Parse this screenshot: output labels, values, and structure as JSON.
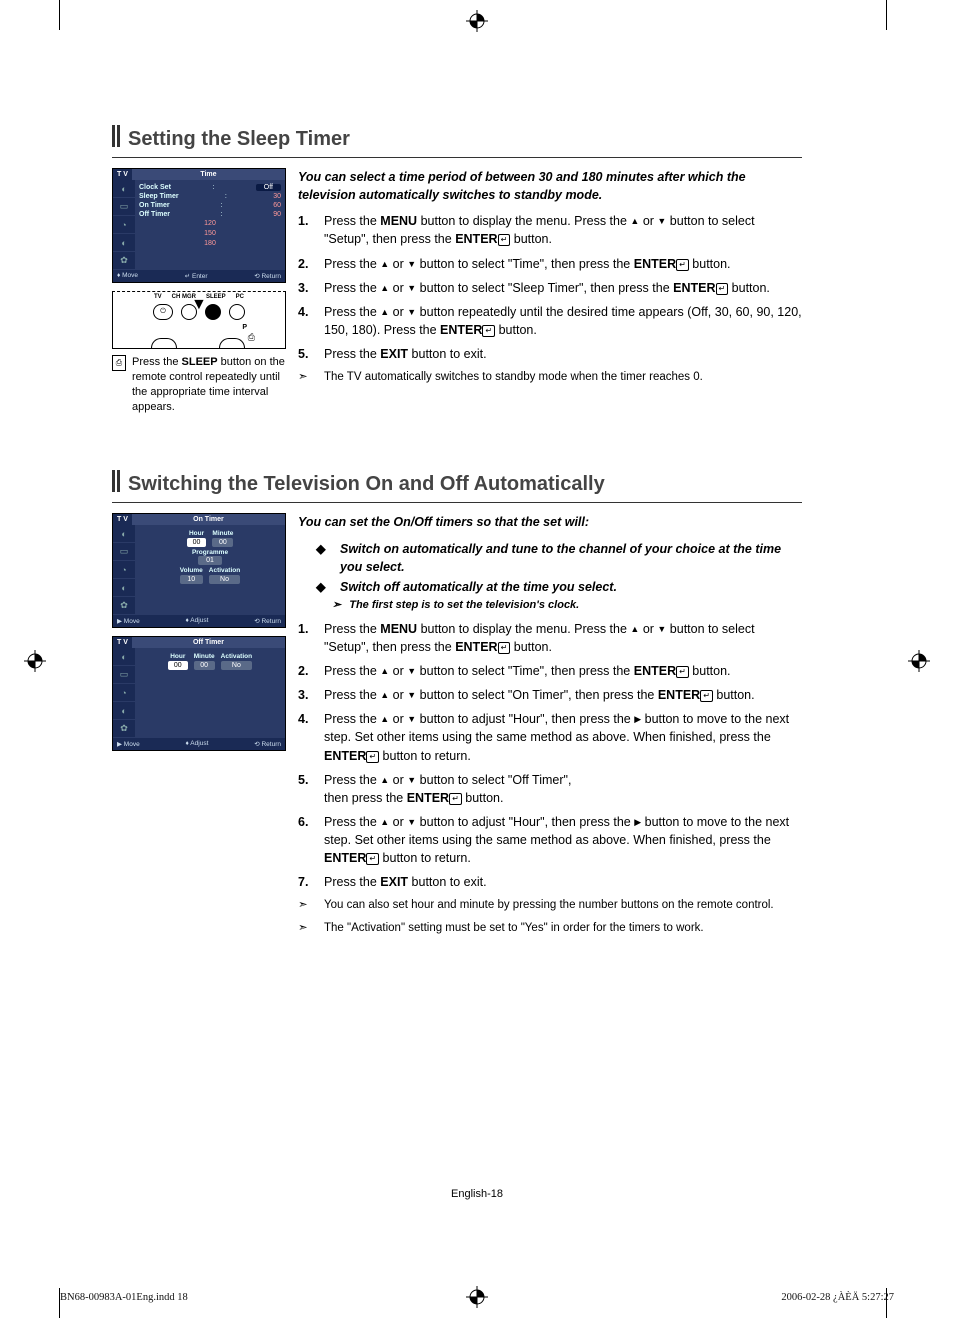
{
  "page_footer": "English-18",
  "print_meta": {
    "file": "BN68-00983A-01Eng.indd   18",
    "date": "2006-02-28   ¿ÀÈÄ 5:27:27"
  },
  "section1": {
    "heading": "Setting the Sleep Timer",
    "intro": "You can select a time period of between 30 and 180 minutes after which the television automatically switches to standby mode.",
    "steps": [
      {
        "n": "1.",
        "pre": "Press the ",
        "b1": "MENU",
        "mid1": " button to display the menu. Press the ",
        "arrows": true,
        "mid2": " button to select \"Setup\", then press the ",
        "b2": "ENTER",
        "post": " button."
      },
      {
        "n": "2.",
        "pre": "Press the ",
        "arrows": true,
        "mid1": " button to select \"Time\", then press the ",
        "b1": "ENTER",
        "post": " button."
      },
      {
        "n": "3.",
        "pre": "Press the ",
        "arrows": true,
        "mid1": " button to select \"Sleep Timer\", then press the ",
        "b1": "ENTER",
        "post": " button."
      },
      {
        "n": "4.",
        "pre": "Press the ",
        "arrows": true,
        "mid1": " button repeatedly until the desired time appears (Off, 30, 60, 90, 120, 150, 180). Press the ",
        "b1": "ENTER",
        "post": " button."
      },
      {
        "n": "5.",
        "pre": "Press the ",
        "b1": "EXIT",
        "post": " button to exit."
      }
    ],
    "note": "The TV automatically switches to standby mode when the timer reaches 0.",
    "tvshot": {
      "tv": "T V",
      "title": "Time",
      "rows": [
        {
          "lab": "Clock Set",
          "val": "Off",
          "sel": true
        },
        {
          "lab": "Sleep Timer",
          "val": "30"
        },
        {
          "lab": "On Timer",
          "val": "60"
        },
        {
          "lab": "Off Timer",
          "val": "90"
        }
      ],
      "opts": [
        "120",
        "150",
        "180"
      ],
      "footer": {
        "a": "♦ Move",
        "b": "↵ Enter",
        "c": "⟲ Return"
      }
    },
    "remote": {
      "labels": [
        "TV",
        "CH MGR",
        "SLEEP",
        "PC"
      ],
      "p": "P"
    },
    "leftnote": {
      "pre": "Press the ",
      "b": "SLEEP",
      "post": " button on the remote control repeatedly until the appropriate time interval appears."
    }
  },
  "section2": {
    "heading": "Switching the Television On and Off Automatically",
    "intro": "You can set the On/Off timers so that the set will:",
    "bullets": [
      "Switch on automatically and tune to the channel of your choice at the time you select.",
      "Switch off automatically at the time you select."
    ],
    "subnote": "The first step is to set the television's clock.",
    "steps": [
      {
        "n": "1.",
        "pre": "Press the ",
        "b1": "MENU",
        "mid1": " button to display the menu. Press the ",
        "arrows": true,
        "mid2": " button to select \"Setup\", then press the ",
        "b2": "ENTER",
        "post": " button."
      },
      {
        "n": "2.",
        "pre": "Press the ",
        "arrows": true,
        "mid1": " button to select \"Time\", then press the ",
        "b1": "ENTER",
        "post": " button."
      },
      {
        "n": "3.",
        "pre": "Press the ",
        "arrows": true,
        "mid1": " button to select \"On Timer\", then press the ",
        "b1": "ENTER",
        "post": " button."
      },
      {
        "n": "4.",
        "pre": "Press the ",
        "arrows": true,
        "mid1": " button to adjust \"Hour\", then press the ",
        "right": true,
        "mid2": " button to move to the next step. Set other items using the same method as above. When finished, press the ",
        "b1": "ENTER",
        "post": " button to return."
      },
      {
        "n": "5.",
        "pre": "Press the ",
        "arrows": true,
        "mid1": " button to select \"Off Timer\",\nthen press the ",
        "b1": "ENTER",
        "post": " button."
      },
      {
        "n": "6.",
        "pre": "Press the ",
        "arrows": true,
        "mid1": " button to adjust \"Hour\", then press the ",
        "right": true,
        "mid2": " button to move to the next step. Set other items using the same method as above. When finished, press the ",
        "b1": "ENTER",
        "post": " button to return."
      },
      {
        "n": "7.",
        "pre": "Press the ",
        "b1": "EXIT",
        "post": " button to exit."
      }
    ],
    "notes": [
      "You can also set hour and minute by pressing the number buttons on the remote control.",
      "The \"Activation\" setting must be set to \"Yes\" in order for the timers to work."
    ],
    "tvshot1": {
      "tv": "T V",
      "title": "On Timer",
      "cols": [
        {
          "h": "Hour",
          "v": "00",
          "sel": true
        },
        {
          "h": "Minute",
          "v": "00"
        }
      ],
      "prog": {
        "h": "Programme",
        "v": "01"
      },
      "cols2": [
        {
          "h": "Volume",
          "v": "10"
        },
        {
          "h": "Activation",
          "v": "No"
        }
      ],
      "footer": {
        "a": "▶ Move",
        "b": "♦ Adjust",
        "c": "⟲ Return"
      }
    },
    "tvshot2": {
      "tv": "T V",
      "title": "Off Timer",
      "cols": [
        {
          "h": "Hour",
          "v": "00",
          "sel": true
        },
        {
          "h": "Minute",
          "v": "00"
        },
        {
          "h": "Activation",
          "v": "No"
        }
      ],
      "footer": {
        "a": "▶ Move",
        "b": "♦ Adjust",
        "c": "⟲ Return"
      }
    }
  }
}
